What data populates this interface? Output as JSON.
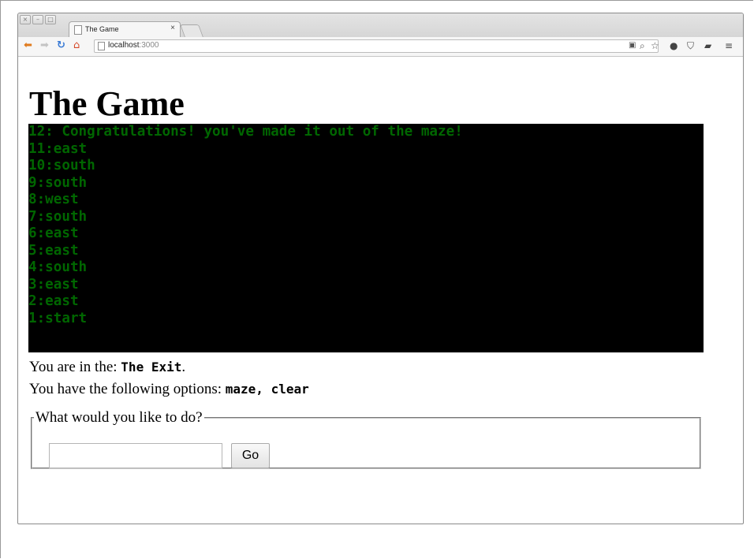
{
  "browser": {
    "tab_title": "The Game",
    "tab_close": "×",
    "url_host": "localhost",
    "url_port": ":3000"
  },
  "page": {
    "heading": "The Game",
    "log_lines": [
      "12: Congratulations! you've made it out of the maze!",
      "11:east",
      "10:south",
      "9:south",
      "8:west",
      "7:south",
      "6:east",
      "5:east",
      "4:south",
      "3:east",
      "2:east",
      "1:start"
    ],
    "location_prefix": "You are in the: ",
    "location_value": "The Exit",
    "location_suffix": ".",
    "options_prefix": "You have the following options: ",
    "options_value": "maze, clear",
    "form_legend": "What would you like to do?",
    "input_value": "",
    "go_label": "Go"
  },
  "colors": {
    "console_bg": "#000000",
    "console_text": "#006600"
  },
  "icons": [
    "close-window-icon",
    "minimize-window-icon",
    "maximize-window-icon",
    "document-icon",
    "back-arrow-icon",
    "forward-arrow-icon",
    "reload-icon",
    "home-icon",
    "page-action-icon",
    "zoom-icon",
    "bookmark-star-icon",
    "circle-extension-icon",
    "pocket-icon",
    "folder-icon",
    "menu-icon"
  ]
}
